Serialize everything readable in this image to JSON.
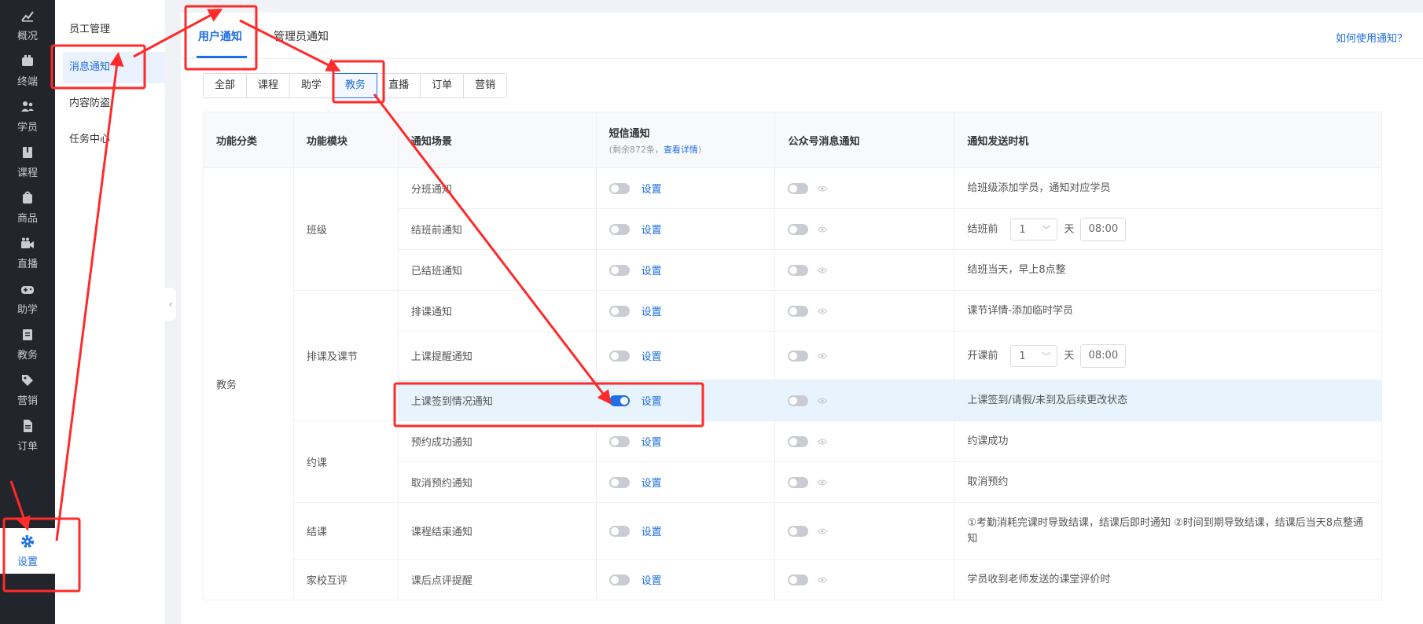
{
  "nav": {
    "items": [
      {
        "label": "概况",
        "icon": "chart-icon"
      },
      {
        "label": "终端",
        "icon": "terminal-icon"
      },
      {
        "label": "学员",
        "icon": "students-icon"
      },
      {
        "label": "课程",
        "icon": "course-icon"
      },
      {
        "label": "商品",
        "icon": "product-icon"
      },
      {
        "label": "直播",
        "icon": "live-icon"
      },
      {
        "label": "助学",
        "icon": "gamepad-icon"
      },
      {
        "label": "教务",
        "icon": "academic-icon"
      },
      {
        "label": "营销",
        "icon": "tag-icon"
      },
      {
        "label": "订单",
        "icon": "order-icon"
      },
      {
        "label": "设置",
        "icon": "gear-icon"
      }
    ]
  },
  "submenu": {
    "items": [
      "员工管理",
      "消息通知",
      "内容防盗",
      "任务中心"
    ]
  },
  "tabs": {
    "user": "用户通知",
    "admin": "管理员通知",
    "help": "如何使用通知？"
  },
  "filters": [
    "全部",
    "课程",
    "助学",
    "教务",
    "直播",
    "订单",
    "营销"
  ],
  "table": {
    "headers": {
      "category": "功能分类",
      "module": "功能模块",
      "scene": "通知场景",
      "sms": "短信通知",
      "sms_remain": "(剩余872条，",
      "sms_detail": "查看详情",
      "sms_tail": ")",
      "wechat": "公众号消息通知",
      "timing": "通知发送时机"
    },
    "category": "教务",
    "modules": [
      "班级",
      "排课及课节",
      "约课",
      "结课",
      "家校互评"
    ],
    "set_label": "设置",
    "rows": [
      {
        "scene": "分班通知",
        "sms_on": false,
        "timing": "给班级添加学员，通知对应学员"
      },
      {
        "scene": "结班前通知",
        "sms_on": false,
        "timing_prefix": "结班前",
        "days": "1",
        "day_unit": "天",
        "time": "08:00"
      },
      {
        "scene": "已结班通知",
        "sms_on": false,
        "timing": "结班当天，早上8点整"
      },
      {
        "scene": "排课通知",
        "sms_on": false,
        "timing": "课节详情-添加临时学员"
      },
      {
        "scene": "上课提醒通知",
        "sms_on": false,
        "timing_prefix": "开课前",
        "days": "1",
        "day_unit": "天",
        "time": "08:00"
      },
      {
        "scene": "上课签到情况通知",
        "sms_on": true,
        "timing": "上课签到/请假/未到及后续更改状态"
      },
      {
        "scene": "预约成功通知",
        "sms_on": false,
        "timing": "约课成功"
      },
      {
        "scene": "取消预约通知",
        "sms_on": false,
        "timing": "取消预约"
      },
      {
        "scene": "课程结束通知",
        "sms_on": false,
        "timing": "①考勤消耗完课时导致结课，结课后即时通知 ②时间到期导致结课，结课后当天8点整通知"
      },
      {
        "scene": "课后点评提醒",
        "sms_on": false,
        "timing": "学员收到老师发送的课堂评价时"
      }
    ]
  },
  "colors": {
    "accent": "#1f6fe5",
    "annotation": "#ff2a2a",
    "highlight_row": "#e7f4fd",
    "nav_bg": "#22252b"
  }
}
